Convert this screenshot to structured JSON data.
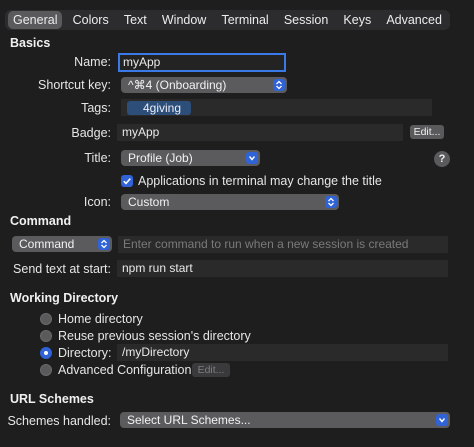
{
  "tabs": [
    {
      "label": "General"
    },
    {
      "label": "Colors"
    },
    {
      "label": "Text"
    },
    {
      "label": "Window"
    },
    {
      "label": "Terminal"
    },
    {
      "label": "Session"
    },
    {
      "label": "Keys"
    },
    {
      "label": "Advanced"
    }
  ],
  "basics": {
    "heading": "Basics",
    "name_label": "Name:",
    "name_value": "myApp",
    "shortcut_label": "Shortcut key:",
    "shortcut_value": "^⌘4 (Onboarding)",
    "tags_label": "Tags:",
    "tag_value": "4giving",
    "badge_label": "Badge:",
    "badge_value": "myApp",
    "badge_edit": "Edit...",
    "title_label": "Title:",
    "title_value": "Profile (Job)",
    "help": "?",
    "apps_change_title": "Applications in terminal may change the title",
    "icon_label": "Icon:",
    "icon_value": "Custom"
  },
  "command": {
    "heading": "Command",
    "mode_value": "Command",
    "command_placeholder": "Enter command to run when a new session is created",
    "send_text_label": "Send text at start:",
    "send_text_value": "npm run start"
  },
  "working_directory": {
    "heading": "Working Directory",
    "options": [
      {
        "label": "Home directory"
      },
      {
        "label": "Reuse previous session's directory"
      },
      {
        "label": "Directory:"
      },
      {
        "label": "Advanced Configuration"
      }
    ],
    "directory_value": "/myDirectory",
    "advanced_edit": "Edit..."
  },
  "url_schemes": {
    "heading": "URL Schemes",
    "handled_label": "Schemes handled:",
    "handled_value": "Select URL Schemes..."
  },
  "colors": {
    "accent": "#2f63d6",
    "background": "#1e1e1e"
  }
}
